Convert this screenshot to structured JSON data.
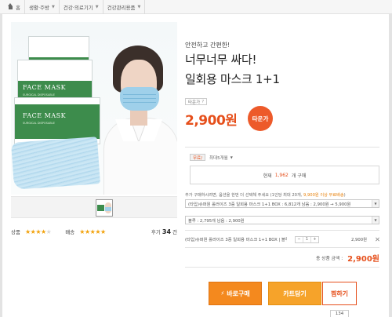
{
  "breadcrumb": {
    "home": "홈",
    "items": [
      "생활·주방",
      "건강·의료기기",
      "건강관리용품"
    ]
  },
  "product": {
    "tagline": "안전하고 간편한!",
    "title_line1": "너무너무 싸다!",
    "title_line2": "일회용 마스크 1+1",
    "box_label": "FACE MASK",
    "box_sub": "SURGICAL DISPOSABLE",
    "small_tag": "타운가",
    "small_tag_q": "?",
    "price": "2,900원",
    "badge": "타운가",
    "ship_chip": "무료/",
    "ship_option": "최대5개월",
    "stock_label": "현재",
    "stock_count": "1,962",
    "stock_suffix": "개 구매",
    "option_note_main": "추가 구매하시려면, 옵션을 한번 더 선택해 주세요 (1인당 최대 20개,",
    "option_note_highlight": "9,900원 이상 무료배송",
    "option_note_end": ")",
    "select1": "(타입)슈퍼원 롤러이즈 3중 일회용 마스크 1+1 BOX : 6,812개 남음 : 2,900원 → 5,900원",
    "select2": "블루 : 2,795개 남음 : 2,900원",
    "picked_name": "(타입)슈퍼원 롤러이즈 3중 일회용 마스크 1+1 BOX | 블루",
    "picked_minus": "−",
    "picked_qty": "1",
    "picked_plus": "+",
    "picked_price": "2,900원",
    "total_label": "총 상품 금액 :",
    "total_value": "2,900원"
  },
  "ratings": {
    "quality_label": "상품",
    "quality_stars": 4,
    "delivery_label": "배송",
    "delivery_stars": 5,
    "reviews_prefix": "후기",
    "reviews_count": "34",
    "reviews_suffix": "건"
  },
  "actions": {
    "buy_now": "바로구매",
    "buy_bolt": "⚡",
    "add_cart": "카트담기",
    "wish": "찜하기",
    "wish_count": "134"
  },
  "colors": {
    "accent": "#e6501c",
    "buy_button": "#f4891e",
    "cart_button": "#f6a32a",
    "star": "#f2a20c"
  }
}
